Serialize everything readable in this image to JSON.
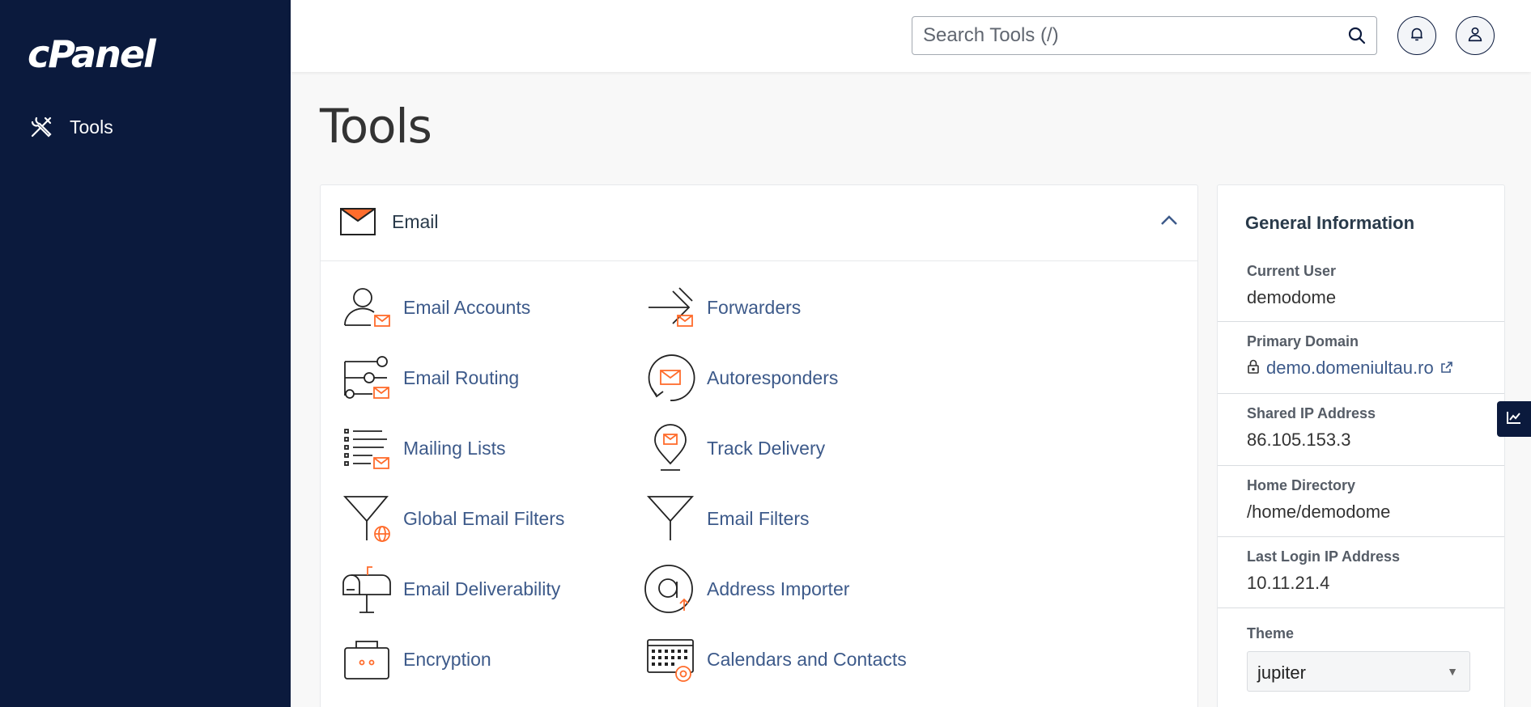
{
  "sidebar": {
    "logo": "cPanel",
    "items": [
      {
        "label": "Tools",
        "icon": "tools-icon"
      }
    ]
  },
  "header": {
    "search": {
      "placeholder": "Search Tools (/)",
      "value": ""
    },
    "buttons": [
      {
        "icon": "bell-icon"
      },
      {
        "icon": "user-icon"
      }
    ]
  },
  "page": {
    "title": "Tools"
  },
  "email_panel": {
    "title": "Email",
    "accent_color": "#ff6c2c",
    "tools": [
      {
        "label": "Email Accounts",
        "icon": "email-accounts-icon"
      },
      {
        "label": "Forwarders",
        "icon": "forwarders-icon"
      },
      {
        "label": "Email Routing",
        "icon": "email-routing-icon"
      },
      {
        "label": "Autoresponders",
        "icon": "autoresponders-icon"
      },
      {
        "label": "Mailing Lists",
        "icon": "mailing-lists-icon"
      },
      {
        "label": "Track Delivery",
        "icon": "track-delivery-icon"
      },
      {
        "label": "Global Email Filters",
        "icon": "global-email-filters-icon"
      },
      {
        "label": "Email Filters",
        "icon": "email-filters-icon"
      },
      {
        "label": "Email Deliverability",
        "icon": "email-deliverability-icon"
      },
      {
        "label": "Address Importer",
        "icon": "address-importer-icon"
      },
      {
        "label": "Encryption",
        "icon": "encryption-icon"
      },
      {
        "label": "Calendars and Contacts",
        "icon": "calendars-contacts-icon"
      }
    ]
  },
  "general_info": {
    "title": "General Information",
    "current_user": {
      "label": "Current User",
      "value": "demodome"
    },
    "primary_domain": {
      "label": "Primary Domain",
      "value": "demo.domeniultau.ro"
    },
    "shared_ip": {
      "label": "Shared IP Address",
      "value": "86.105.153.3"
    },
    "home_directory": {
      "label": "Home Directory",
      "value": "/home/demodome"
    },
    "last_login_ip": {
      "label": "Last Login IP Address",
      "value": "10.11.21.4"
    },
    "theme": {
      "label": "Theme",
      "value": "jupiter"
    }
  },
  "side_tab": {
    "icon": "stats-chart-icon"
  }
}
